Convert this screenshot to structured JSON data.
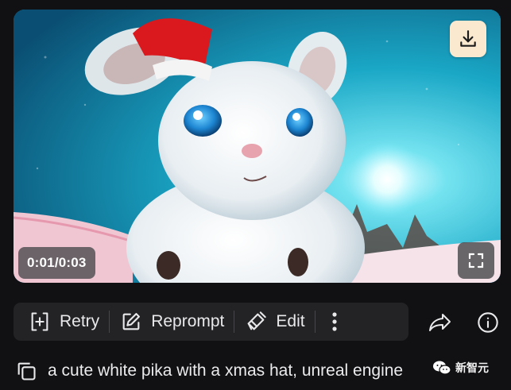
{
  "video": {
    "time_display": "0:01/0:03",
    "download_icon": "download-icon",
    "fullscreen_icon": "fullscreen-icon"
  },
  "toolbar": {
    "retry_label": "Retry",
    "reprompt_label": "Reprompt",
    "edit_label": "Edit",
    "retry_icon": "retry-icon",
    "reprompt_icon": "pencil-square-icon",
    "edit_icon": "brush-icon",
    "more_icon": "more-vertical-icon"
  },
  "actions": {
    "share_icon": "share-arrow-icon",
    "info_icon": "info-icon"
  },
  "prompt": {
    "copy_icon": "copy-icon",
    "text": "a cute white pika with a xmas hat, unreal engine"
  },
  "watermark": {
    "text": "新智元"
  },
  "colors": {
    "background": "#111113",
    "toolbar_bg": "#232326",
    "download_bg": "#fbe9cf",
    "text": "#e9e9ec"
  }
}
